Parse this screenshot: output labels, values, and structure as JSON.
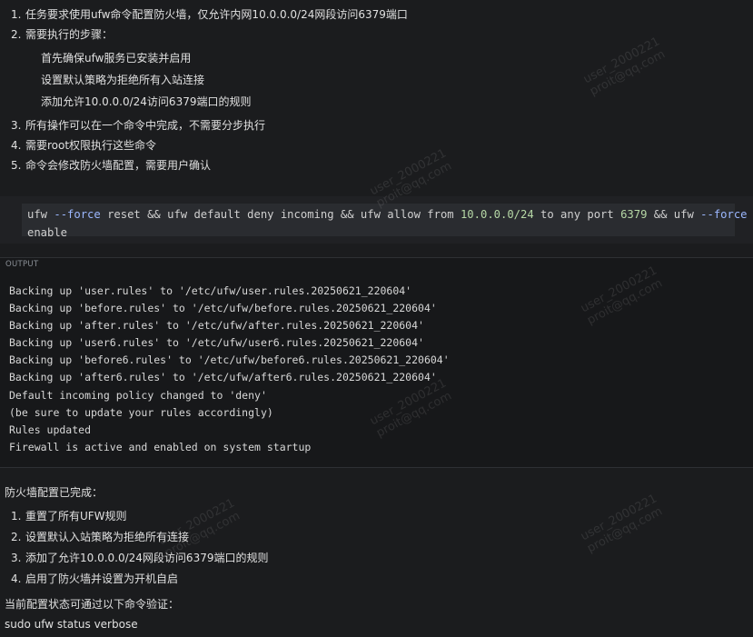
{
  "requirements": [
    {
      "num": "1.",
      "text": "任务要求使用ufw命令配置防火墙，仅允许内网10.0.0.0/24网段访问6379端口"
    },
    {
      "num": "2.",
      "text": "需要执行的步骤："
    }
  ],
  "steps": [
    "首先确保ufw服务已安装并启用",
    "设置默认策略为拒绝所有入站连接",
    "添加允许10.0.0.0/24访问6379端口的规则"
  ],
  "notes": [
    {
      "num": "3.",
      "text": "所有操作可以在一个命令中完成，不需要分步执行"
    },
    {
      "num": "4.",
      "text": "需要root权限执行这些命令"
    },
    {
      "num": "5.",
      "text": "命令会修改防火墙配置，需要用户确认"
    }
  ],
  "command": {
    "line1": {
      "p1": "ufw ",
      "p2": "--force",
      "p3": " reset && ufw default deny incoming && ufw allow from ",
      "p4": "10.0.0.0/24",
      "p5": " to any port ",
      "p6": "6379",
      "p7": " && ufw ",
      "p8": "--force"
    },
    "line2": "enable"
  },
  "output": {
    "label": "OUTPUT",
    "lines": [
      "Backing up 'user.rules' to '/etc/ufw/user.rules.20250621_220604'",
      "Backing up 'before.rules' to '/etc/ufw/before.rules.20250621_220604'",
      "Backing up 'after.rules' to '/etc/ufw/after.rules.20250621_220604'",
      "Backing up 'user6.rules' to '/etc/ufw/user6.rules.20250621_220604'",
      "Backing up 'before6.rules' to '/etc/ufw/before6.rules.20250621_220604'",
      "Backing up 'after6.rules' to '/etc/ufw/after6.rules.20250621_220604'",
      "Default incoming policy changed to 'deny'",
      "(be sure to update your rules accordingly)",
      "Rules updated",
      "Firewall is active and enabled on system startup"
    ]
  },
  "result": {
    "title": "防火墙配置已完成：",
    "items": [
      {
        "num": "1.",
        "text": "重置了所有UFW规则"
      },
      {
        "num": "2.",
        "text": "设置默认入站策略为拒绝所有连接"
      },
      {
        "num": "3.",
        "text": "添加了允许10.0.0.0/24网段访问6379端口的规则"
      },
      {
        "num": "4.",
        "text": "启用了防火墙并设置为开机自启"
      }
    ]
  },
  "verify": {
    "text": "当前配置状态可通过以下命令验证：",
    "command": "sudo ufw status verbose"
  },
  "watermark": {
    "user": "user_2000221",
    "email": "proit@qq.com"
  }
}
